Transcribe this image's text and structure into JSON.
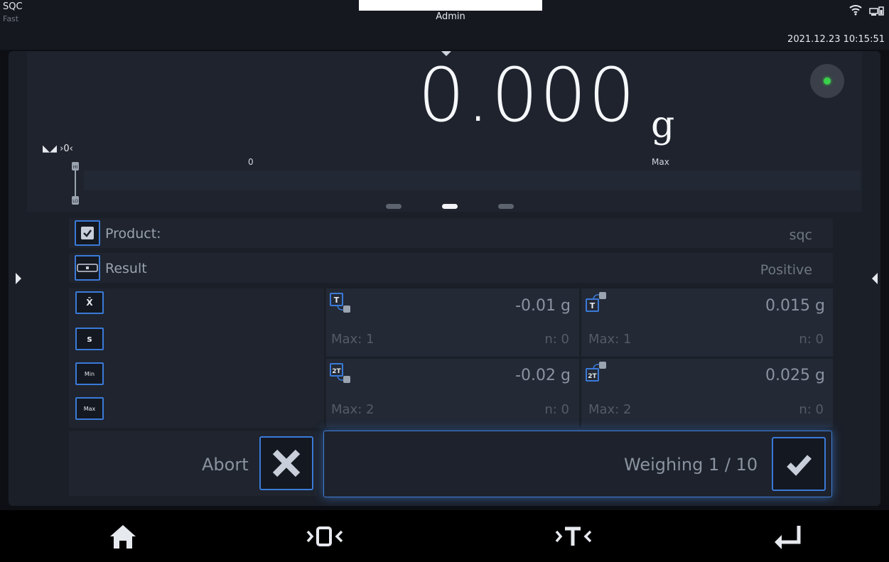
{
  "status": {
    "mode": "SQC",
    "speed": "Fast",
    "user": "Admin",
    "datetime": "2021.12.23 10:15:51",
    "icons": [
      "wifi-icon",
      "battery-icon"
    ]
  },
  "display": {
    "weight": "0.000",
    "unit": "g",
    "zero_indicator": "◣◢ ›0‹",
    "bar_min": "0",
    "bar_max": "Max",
    "stability_color": "#3ad14a"
  },
  "pages": {
    "count": 3,
    "active": 2
  },
  "info": {
    "product_label": "Product:",
    "product_value": "sqc",
    "result_label": "Result",
    "result_value": "Positive"
  },
  "stats_buttons": [
    "X̄",
    "s",
    "Min",
    "Max"
  ],
  "thresholds": [
    {
      "icon": "t-lo-icon",
      "value": "-0.01 g",
      "max": "Max: 1",
      "n": "n: 0"
    },
    {
      "icon": "t-hi-icon",
      "value": "0.015 g",
      "max": "Max: 1",
      "n": "n: 0"
    },
    {
      "icon": "2t-lo-icon",
      "value": "-0.02 g",
      "max": "Max: 2",
      "n": "n: 0"
    },
    {
      "icon": "2t-hi-icon",
      "value": "0.025 g",
      "max": "Max: 2",
      "n": "n: 0"
    }
  ],
  "actions": {
    "abort_label": "Abort",
    "weighing_label": "Weighing 1 / 10"
  },
  "bottom": {
    "buttons": [
      "home-icon",
      "zero-icon",
      "tare-icon",
      "enter-icon"
    ]
  },
  "colors": {
    "accent": "#3a7ad9",
    "background": "#1b1f28"
  }
}
